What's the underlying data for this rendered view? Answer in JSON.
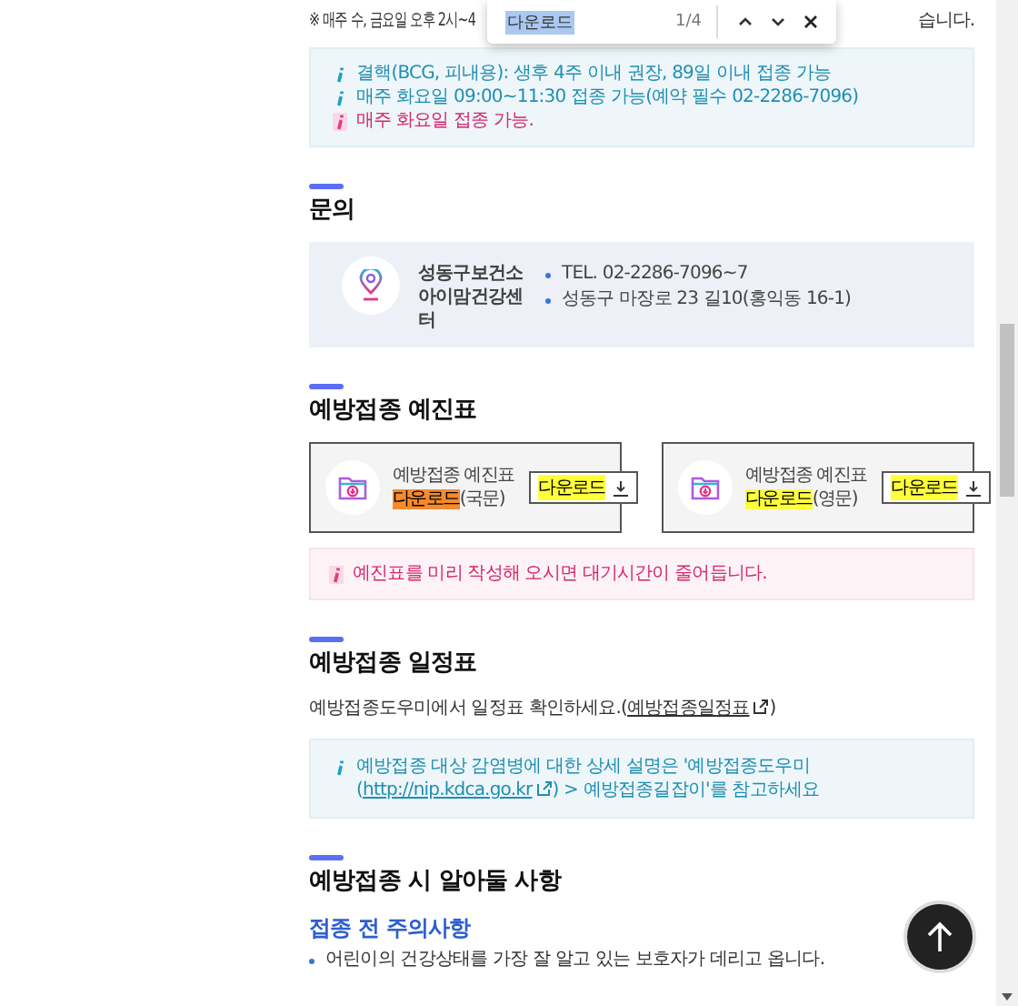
{
  "find_bar": {
    "query": "다운로드",
    "count": "1/4"
  },
  "top_note": {
    "left": "※ 매주 수, 금요일 오후 2시~4",
    "right": "습니다."
  },
  "notes_box": {
    "items": [
      {
        "kind": "info",
        "parts": [
          {
            "text": "결핵(BCG, 피내용): 생후 4주 이내 권장, 89일 이내 접종 가능"
          }
        ]
      },
      {
        "kind": "info",
        "parts": [
          {
            "text": "매주 화요일 09:00~11:30 접종 가능(예약 필수 02-2286-7096)"
          }
        ]
      },
      {
        "kind": "alert",
        "parts": [
          {
            "text": "매주 화요일 접종 가능."
          }
        ]
      }
    ]
  },
  "contact": {
    "title": "문의",
    "name": "성동구보건소 아이맘건강센터",
    "rows": [
      "TEL. 02-2286-7096~7",
      "성동구 마장로 23 길10(홍익동 16-1)"
    ]
  },
  "questionnaire": {
    "title": "예방접종 예진표",
    "cards": [
      {
        "parts": [
          {
            "text": "예방접종 예진표 "
          },
          {
            "text": "다운로드",
            "search_match": true,
            "current_match": true
          },
          {
            "text": "(국문)"
          }
        ],
        "button": {
          "text": "다운로드",
          "search_match": true,
          "current_match": false
        }
      },
      {
        "parts": [
          {
            "text": "예방접종 예진표 "
          },
          {
            "text": "다운로드",
            "search_match": true,
            "current_match": false
          },
          {
            "text": "(영문)"
          }
        ],
        "button": {
          "text": "다운로드",
          "search_match": true,
          "current_match": false
        }
      }
    ],
    "note": {
      "kind": "alert",
      "parts": [
        {
          "text": "예진표를 미리 작성해 오시면 대기시간이 줄어듭니다."
        }
      ]
    }
  },
  "schedule": {
    "title": "예방접종 일정표",
    "paragraph": {
      "parts": [
        {
          "text": "예방접종도우미에서 일정표 확인하세요.("
        },
        {
          "text": "예방접종일정표",
          "link": true
        },
        {
          "text": ")"
        }
      ]
    },
    "note": {
      "kind": "info",
      "parts": [
        {
          "text": "예방접종 대상 감염병에 대한 상세 설명은 '예방접종도우미("
        },
        {
          "text": "http://nip.kdca.go.kr",
          "link": true
        },
        {
          "text": ") > 예방접종길잡이'를 참고하세요"
        }
      ]
    }
  },
  "precautions": {
    "title": "예방접종 시 알아둘 사항",
    "subtitle": "접종 전 주의사항",
    "bullets": [
      "어린이의 건강상태를 가장 잘 알고 있는 보호자가 데리고 옵니다."
    ]
  }
}
